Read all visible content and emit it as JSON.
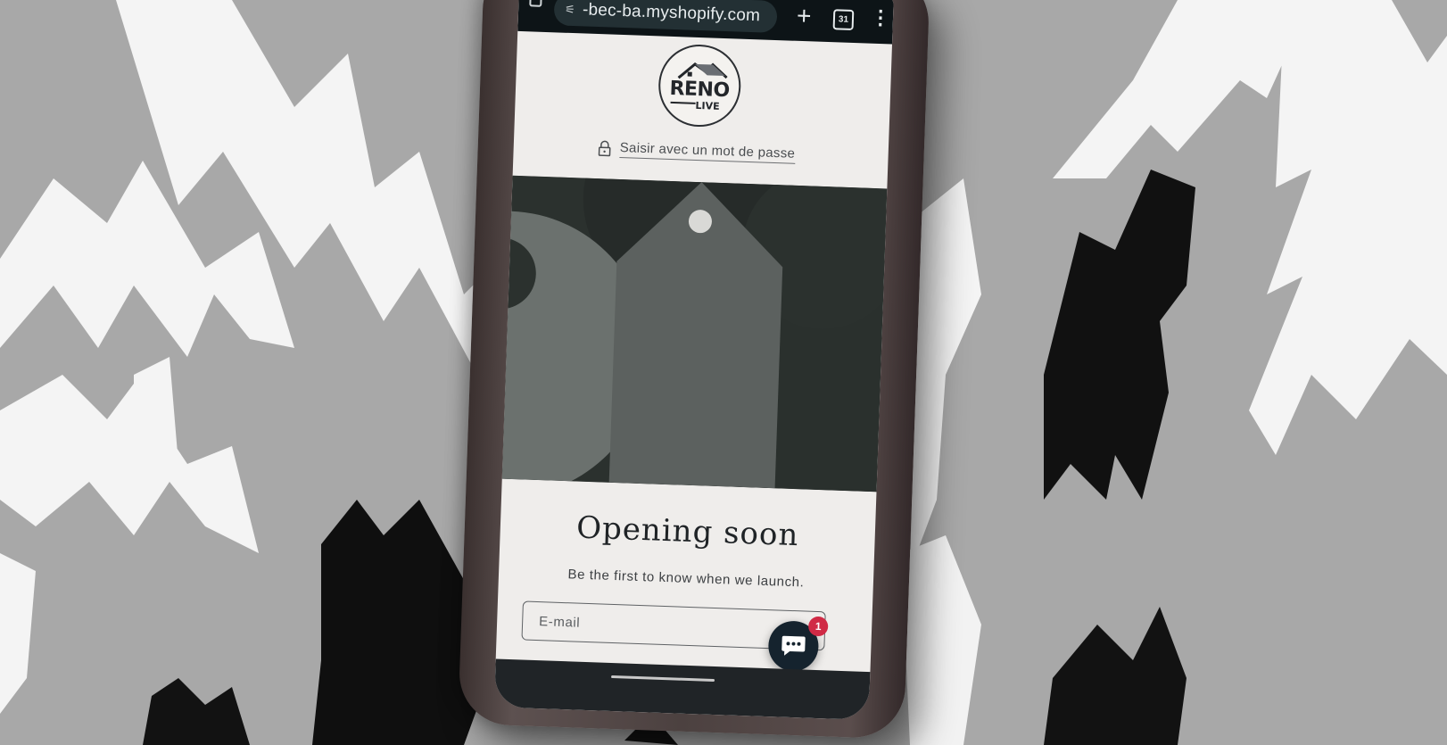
{
  "browser": {
    "url": "-bec-ba.myshopify.com",
    "tune_icon": "site-settings-icon",
    "new_tab_label": "+",
    "tab_count": "31",
    "menu_label": "⋮"
  },
  "store": {
    "logo_name": "RENO",
    "logo_sub": "LIVE",
    "password_link": "Saisir avec un mot de passe"
  },
  "main": {
    "headline": "Opening soon",
    "subline": "Be the first to know when we launch.",
    "email_placeholder": "E-mail"
  },
  "chat": {
    "badge_count": "1"
  },
  "colors": {
    "browser_bar": "#0d1417",
    "page_bg": "#efedeb",
    "hero_dark": "#2b312e",
    "hero_tag": "#5c615f",
    "chat_button": "#15232e",
    "badge": "#d02a45"
  }
}
